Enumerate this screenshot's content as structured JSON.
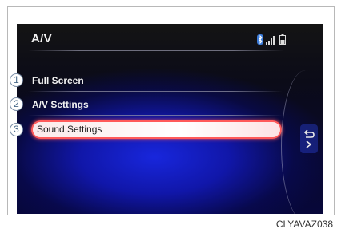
{
  "screen": {
    "title": "A/V",
    "status_icons": [
      "bluetooth-icon",
      "signal-strength-icon",
      "battery-icon"
    ],
    "menu_items": [
      {
        "label": "Full Screen",
        "callout": "1"
      },
      {
        "label": "A/V Settings",
        "callout": "2"
      },
      {
        "label": "Sound Settings",
        "callout": "3",
        "selected": true
      }
    ],
    "back_icon": "return-arrow-icon"
  },
  "caption": "CLYAVAZ038",
  "colors": {
    "highlight_border": "#ff5a5a",
    "screen_blue": "#1a28e6",
    "callout_text": "#4a6a8a"
  }
}
